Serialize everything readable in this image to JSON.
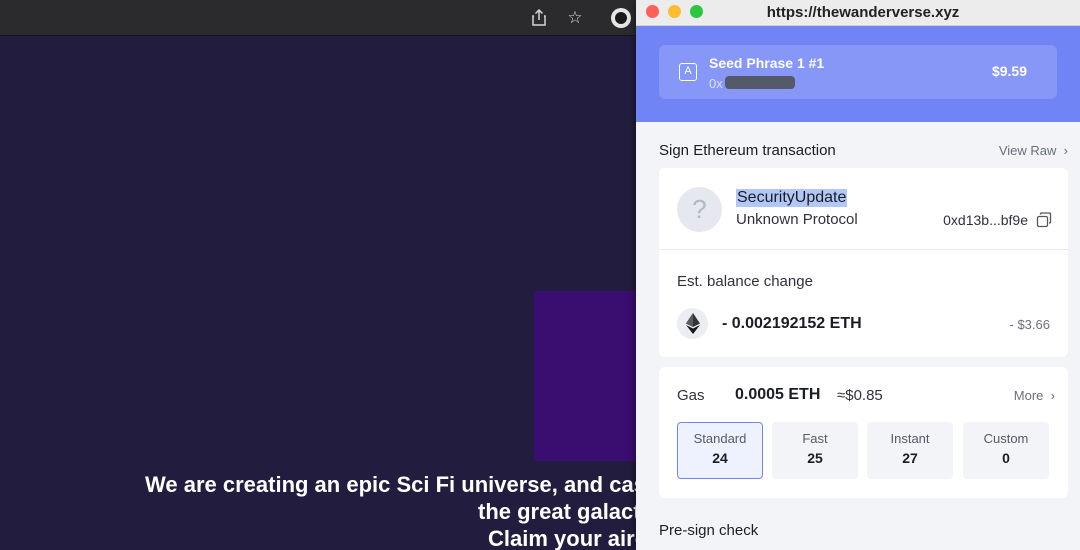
{
  "browser": {
    "share_icon": "share-icon",
    "star_icon": "star-icon",
    "hero_lines": [
      "We are creating an epic Sci Fi universe, and cast",
      "the great galact",
      "Claim your airc"
    ]
  },
  "popup": {
    "url": "https://thewanderverse.xyz",
    "account": {
      "name": "Seed Phrase 1 #1",
      "address_prefix": "0x",
      "balance": "$9.59"
    },
    "header": {
      "title": "Sign Ethereum transaction",
      "view_raw": "View Raw"
    },
    "protocol": {
      "avatar": "?",
      "name": "SecurityUpdate",
      "type": "Unknown Protocol",
      "address": "0xd13b...bf9e"
    },
    "balance_change": {
      "label": "Est. balance change",
      "amount": "- 0.002192152 ETH",
      "usd": "- $3.66"
    },
    "gas": {
      "label": "Gas",
      "eth": "0.0005 ETH",
      "usd": "≈$0.85",
      "more": "More",
      "options": [
        {
          "label": "Standard",
          "value": "24",
          "selected": true
        },
        {
          "label": "Fast",
          "value": "25"
        },
        {
          "label": "Instant",
          "value": "27"
        },
        {
          "label": "Custom",
          "value": "0"
        }
      ]
    },
    "presign": "Pre-sign check",
    "colors": {
      "accent": "#7184f6",
      "account_card": "#8697f8",
      "page_bg": "#221c3e"
    }
  }
}
